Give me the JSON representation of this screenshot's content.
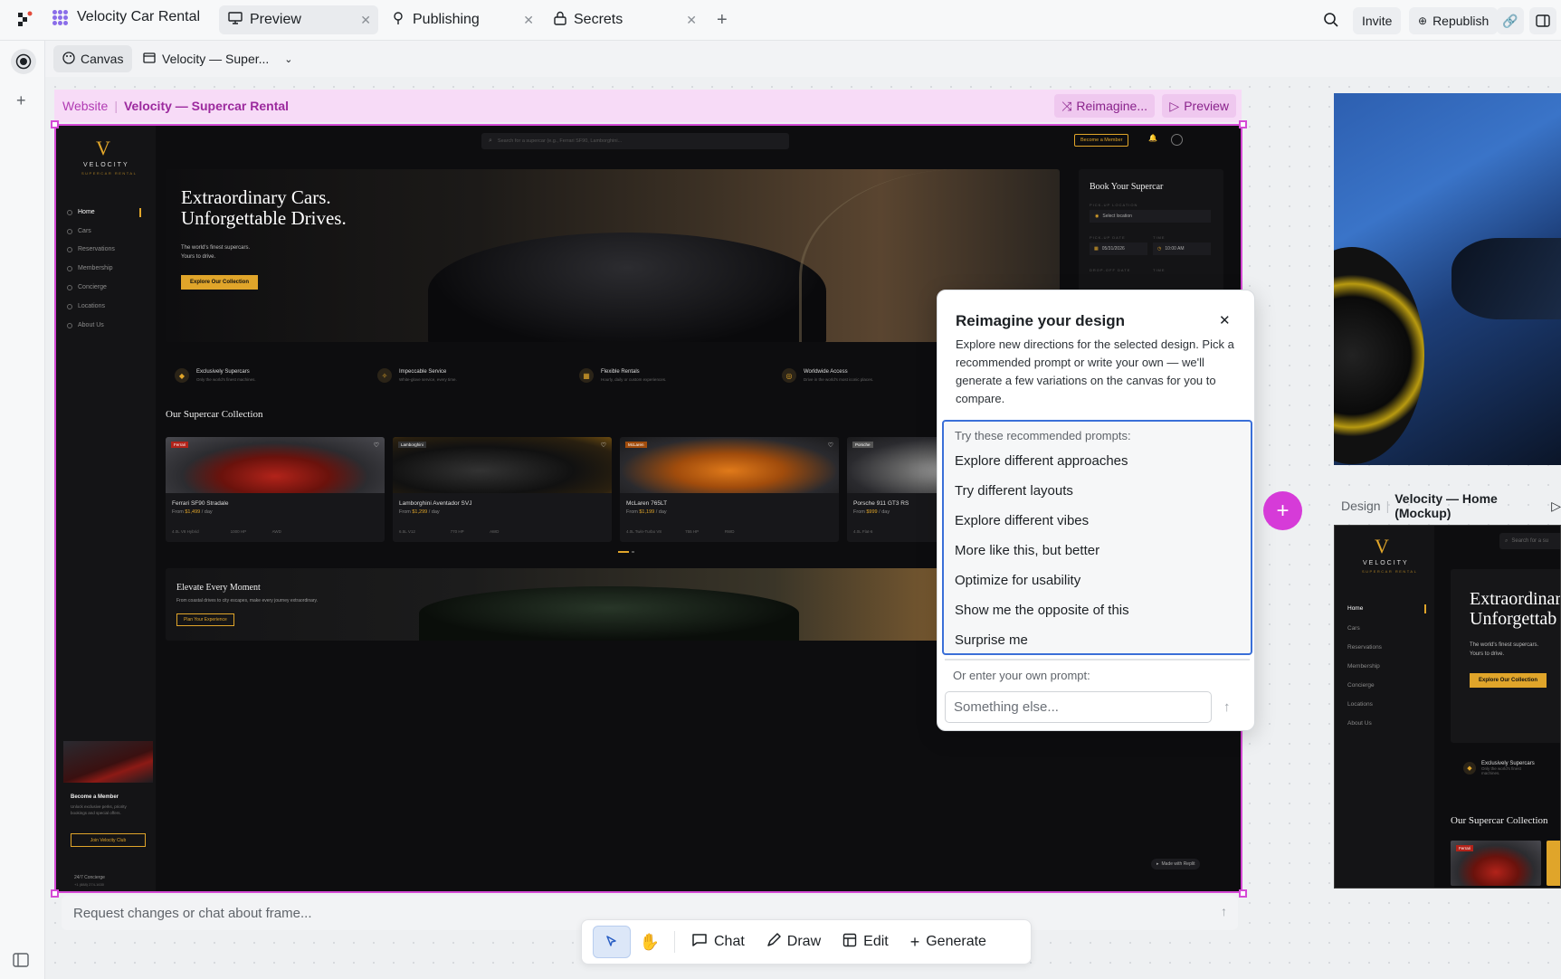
{
  "topbar": {
    "project_title": "Velocity Car Rental",
    "tabs": [
      {
        "label": "Preview",
        "icon": "monitor-icon"
      },
      {
        "label": "Publishing",
        "icon": "publish-icon"
      },
      {
        "label": "Secrets",
        "icon": "lock-icon"
      }
    ],
    "invite_label": "Invite",
    "republish_label": "Republish"
  },
  "subbar": {
    "canvas_label": "Canvas",
    "frame_select_label": "Velocity — Super..."
  },
  "frame": {
    "type_label": "Website",
    "name": "Velocity — Supercar Rental",
    "reimagine_label": "Reimagine...",
    "preview_label": "Preview"
  },
  "site": {
    "brand": "VELOCITY",
    "brand_sub": "SUPERCAR RENTAL",
    "search_placeholder": "Search for a supercar (e.g., Ferrari SF90, Lamborghini...",
    "become_member": "Become a Member",
    "nav": [
      "Home",
      "Cars",
      "Reservations",
      "Membership",
      "Concierge",
      "Locations",
      "About Us"
    ],
    "hero_title_1": "Extraordinary Cars.",
    "hero_title_2": "Unforgettable Drives.",
    "hero_sub_1": "The world's finest supercars.",
    "hero_sub_2": "Yours to drive.",
    "hero_cta": "Explore Our Collection",
    "booking": {
      "title": "Book Your Supercar",
      "pickup_location_label": "PICK-UP LOCATION",
      "location_value": "Select location",
      "pickup_date_label": "PICK-UP DATE",
      "time_label": "TIME",
      "date_value": "05/31/2026",
      "time_value": "10:00 AM",
      "dropoff_label": "DROP-OFF DATE",
      "dropoff_time_label": "TIME"
    },
    "features": [
      {
        "title": "Exclusively Supercars",
        "sub": "Only the world's finest machines."
      },
      {
        "title": "Impeccable Service",
        "sub": "White-glove service, every time."
      },
      {
        "title": "Flexible Rentals",
        "sub": "Hourly, daily or custom experiences."
      },
      {
        "title": "Worldwide Access",
        "sub": "Drive in the world's most iconic places."
      }
    ],
    "collection_title": "Our Supercar Collection",
    "cars": [
      {
        "brand": "Ferrari",
        "name": "Ferrari SF90 Stradale",
        "price": "$1,499",
        "unit": "/ day",
        "spec1": "4.0L V8 Hybrid",
        "spec2": "1000 HP",
        "spec3": "AWD"
      },
      {
        "brand": "Lamborghini",
        "name": "Lamborghini Aventador SVJ",
        "price": "$1,299",
        "unit": "/ day",
        "spec1": "6.5L V12",
        "spec2": "770 HP",
        "spec3": "AWD"
      },
      {
        "brand": "McLaren",
        "name": "McLaren 765LT",
        "price": "$1,199",
        "unit": "/ day",
        "spec1": "4.0L Twin-Turbo V8",
        "spec2": "755 HP",
        "spec3": "RWD"
      },
      {
        "brand": "Porsche",
        "name": "Porsche 911 GT3 RS",
        "price": "$999",
        "unit": "/ day",
        "spec1": "4.0L Flat-6",
        "spec2": "",
        "spec3": ""
      }
    ],
    "elevate_title": "Elevate Every Moment",
    "elevate_sub": "From coastal drives to city escapes, make every journey extraordinary.",
    "elevate_cta": "Plan Your Experience",
    "member_card": {
      "title": "Become a Member",
      "text": "Unlock exclusive perks, priority bookings and special offers.",
      "cta": "Join Velocity Club"
    },
    "concierge": "24/7 Concierge",
    "concierge_phone": "+1 (888) 274-1630",
    "made_with": "Made with Replit"
  },
  "popup": {
    "title": "Reimagine your design",
    "description": "Explore new directions for the selected design. Pick a recommended prompt or write your own — we'll generate a few variations on the canvas for you to compare.",
    "prompts_heading": "Try these recommended prompts:",
    "prompts": [
      "Explore different approaches",
      "Try different layouts",
      "Explore different vibes",
      "More like this, but better",
      "Optimize for usability",
      "Show me the opposite of this",
      "Surprise me"
    ],
    "own_prompt_label": "Or enter your own prompt:",
    "input_placeholder": "Something else..."
  },
  "right_frame": {
    "type_label": "Design",
    "name": "Velocity — Home (Mockup)",
    "brand": "VELOCITY",
    "brand_sub": "SUPERCAR RENTAL",
    "search_placeholder": "Search for a su",
    "hero_1": "Extraordinar",
    "hero_2": "Unforgettab",
    "hero_sub_1": "The world's finest supercars.",
    "hero_sub_2": "Yours to drive.",
    "cta": "Explore Our Collection",
    "feature_title": "Exclusively Supercars",
    "feature_sub": "Only the world's finest machines.",
    "collection_title": "Our Supercar Collection",
    "car_brand": "Ferrari"
  },
  "chat": {
    "placeholder": "Request changes or chat about frame..."
  },
  "tools": {
    "chat": "Chat",
    "draw": "Draw",
    "edit": "Edit",
    "generate": "Generate"
  },
  "colors": {
    "frame_accent": "#d54ad6",
    "gold": "#e0a52a",
    "plus_button": "#d63bd8",
    "prompt_border": "#3a6fd8"
  }
}
